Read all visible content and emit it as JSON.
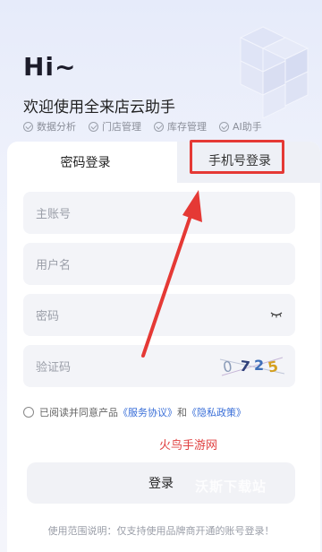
{
  "hero": {
    "greeting": "Hi~",
    "welcome": "欢迎使用全来店云助手"
  },
  "features": [
    "数据分析",
    "门店管理",
    "库存管理",
    "AI助手"
  ],
  "tabs": {
    "password_login": "密码登录",
    "phone_login": "手机号登录"
  },
  "form": {
    "main_account_placeholder": "主账号",
    "username_placeholder": "用户名",
    "password_placeholder": "密码",
    "captcha_placeholder": "验证码",
    "captcha_text": "0725"
  },
  "agreement": {
    "prefix": "已阅读并同意产品",
    "service": "《服务协议》",
    "and": "和",
    "privacy": "《隐私政策》"
  },
  "watermark_top": "火鸟手游网",
  "login_button": "登录",
  "watermark_bottom": "沃斯下载站",
  "footer": "使用范围说明：仅支持使用品牌商开通的账号登录！",
  "colors": {
    "highlight_red": "#e53935",
    "link_blue": "#3a6fd8"
  }
}
